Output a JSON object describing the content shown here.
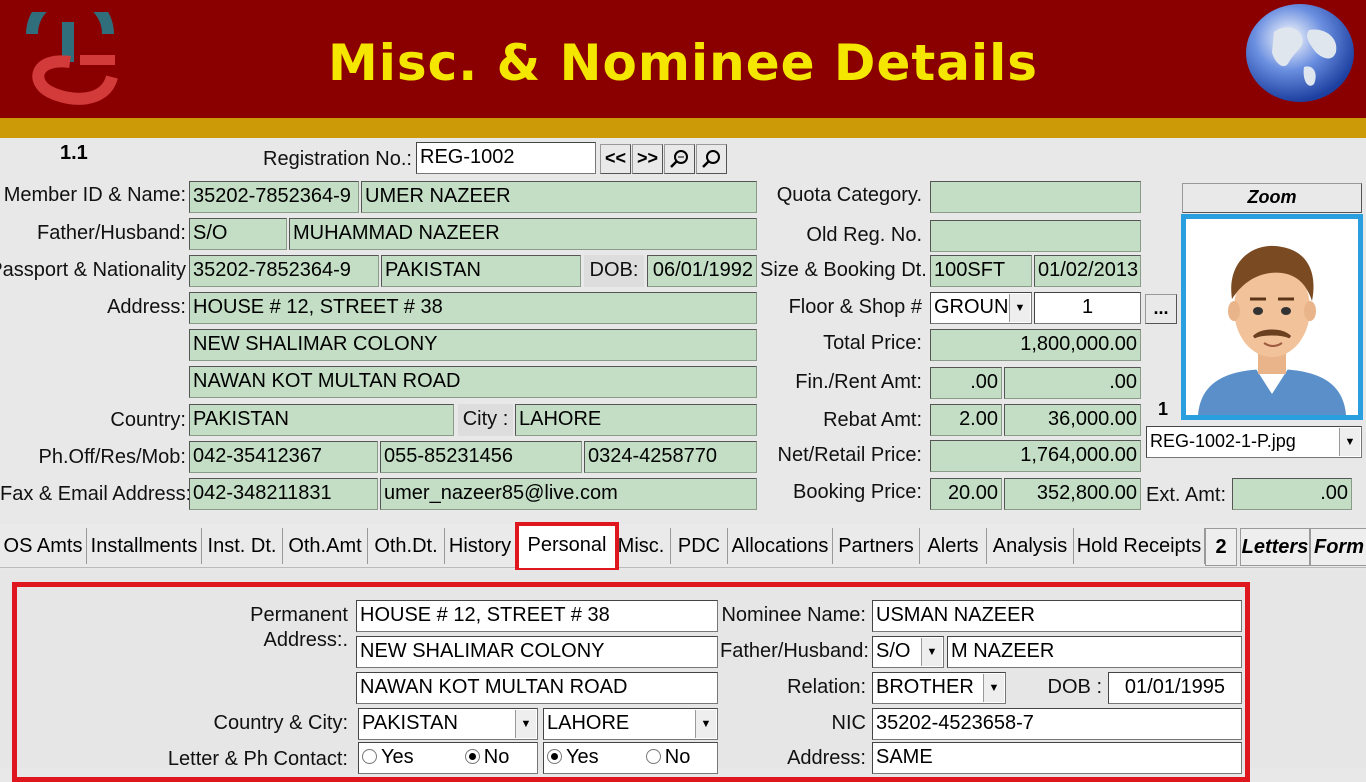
{
  "header": {
    "title": "Misc. & Nominee Details",
    "brand_color": "#8a0000",
    "title_color": "#f5e600",
    "logo_icon": "ts-logo-icon",
    "globe_icon": "globe-icon"
  },
  "form": {
    "version": "1.1",
    "registration_label": "Registration No.:",
    "registration_value": "REG-1002",
    "nav_prev": "<<",
    "nav_next": ">>",
    "member_label": "Member ID & Name:",
    "member_id": "35202-7852364-9",
    "member_name": "UMER NAZEER",
    "father_label": "Father/Husband:",
    "father_rel": "S/O",
    "father_name": "MUHAMMAD NAZEER",
    "passport_label": "Passport & Nationality:",
    "passport_no": "35202-7852364-9",
    "nationality": "PAKISTAN",
    "dob_label": "DOB:",
    "dob": "06/01/1992",
    "address_label": "Address:",
    "address_line1": "HOUSE # 12, STREET # 38",
    "address_line2": "NEW SHALIMAR COLONY",
    "address_line3": "NAWAN KOT MULTAN ROAD",
    "country_label": "Country:",
    "country": "PAKISTAN",
    "city_label": "City :",
    "city": "LAHORE",
    "phone_label": "Ph.Off/Res/Mob:",
    "phone_off": "042-35412367",
    "phone_res": "055-85231456",
    "phone_mob": "0324-4258770",
    "fax_label": "Fax & Email Address:",
    "fax": "042-348211831",
    "email": "umer_nazeer85@live.com",
    "quota_label": "Quota Category.",
    "quota": "",
    "oldreg_label": "Old Reg. No.",
    "oldreg": "",
    "size_label": "Size & Booking Dt.",
    "size": "100SFT",
    "booking_date": "01/02/2013",
    "floor_label": "Floor & Shop #",
    "floor": "GROUNI",
    "shop_no": "1",
    "more_btn": "...",
    "total_label": "Total Price:",
    "total": "1,800,000.00",
    "fin_label": "Fin./Rent Amt:",
    "fin_pct": ".00",
    "fin_amt": ".00",
    "rebate_label": "Rebat Amt:",
    "rebate_pct": "2.00",
    "rebate_amt": "36,000.00",
    "net_label": "Net/Retail Price:",
    "net": "1,764,000.00",
    "booking_label": "Booking Price:",
    "booking_pct": "20.00",
    "booking_amt": "352,800.00",
    "ext_label": "Ext. Amt:",
    "ext_amt": ".00",
    "zoom_label": "Zoom",
    "photo_index": "1",
    "photo_file": "REG-1002-1-P.jpg"
  },
  "tabs": [
    {
      "label": "OS Amts"
    },
    {
      "label": "Installments"
    },
    {
      "label": "Inst. Dt."
    },
    {
      "label": "Oth.Amt"
    },
    {
      "label": "Oth.Dt."
    },
    {
      "label": "History"
    },
    {
      "label": "Personal"
    },
    {
      "label": "Misc."
    },
    {
      "label": "PDC"
    },
    {
      "label": "Allocations"
    },
    {
      "label": "Partners"
    },
    {
      "label": "Alerts"
    },
    {
      "label": "Analysis"
    },
    {
      "label": "Hold Receipts"
    },
    {
      "label": "2"
    },
    {
      "label": "Letters"
    },
    {
      "label": "Form"
    }
  ],
  "personal": {
    "perm_label1": "Permanent",
    "perm_label2": "Address:.",
    "perm_line1": "HOUSE # 12, STREET # 38",
    "perm_line2": "NEW SHALIMAR COLONY",
    "perm_line3": "NAWAN KOT MULTAN ROAD",
    "country_city_label": "Country & City:",
    "country": "PAKISTAN",
    "city": "LAHORE",
    "contact_label": "Letter & Ph Contact:",
    "yes": "Yes",
    "no": "No",
    "nominee_label": "Nominee Name:",
    "nominee": "USMAN NAZEER",
    "nom_father_label": "Father/Husband:",
    "nom_rel": "S/O",
    "nom_father": "M NAZEER",
    "relation_label": "Relation:",
    "relation": "BROTHER",
    "nom_dob_label": "DOB :",
    "nom_dob": "01/01/1995",
    "nic_label": "NIC",
    "nic": "35202-4523658-7",
    "nom_address_label": "Address:",
    "nom_address": "SAME"
  }
}
